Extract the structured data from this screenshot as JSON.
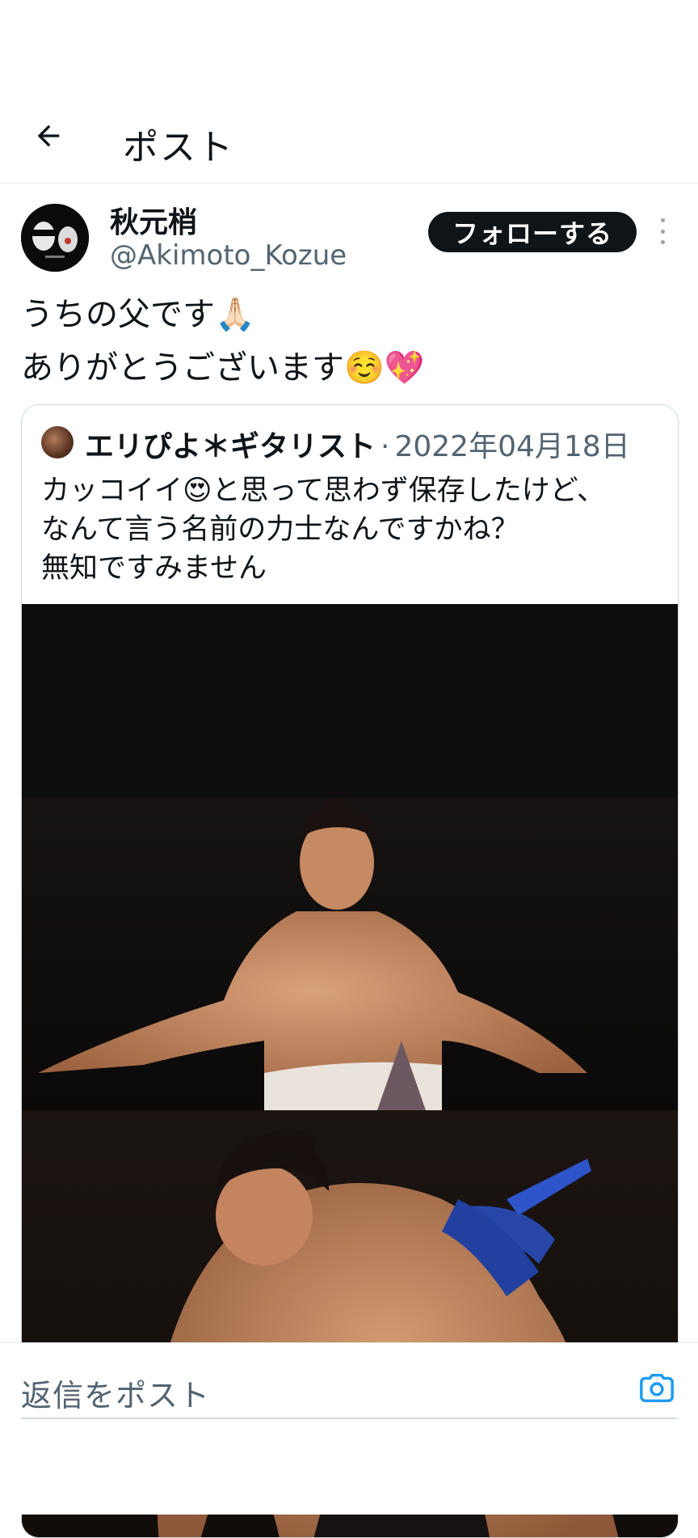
{
  "header": {
    "title": "ポスト",
    "back_icon": "arrow-left-icon"
  },
  "post": {
    "author": {
      "display_name": "秋元梢",
      "handle": "@Akimoto_Kozue"
    },
    "follow_label": "フォローする",
    "more_icon": "more-vertical-icon",
    "text": "うちの父です🙏🏻\nありがとうございます☺️💖",
    "quote": {
      "author_name": "エリぴよ＊ギタリスト",
      "separator": "·",
      "date": "2022年04月18日",
      "text": "カッコイイ😍と思って思わず保存したけど、\nなんて言う名前の力士なんですかね？\n無知ですみません",
      "media_description": "sumo-wrestler-photos"
    }
  },
  "reply": {
    "placeholder": "返信をポスト",
    "camera_icon": "camera-icon"
  },
  "colors": {
    "text_primary": "#0f1419",
    "text_secondary": "#536471",
    "accent": "#1d9bf0",
    "border": "#cfd9de"
  }
}
